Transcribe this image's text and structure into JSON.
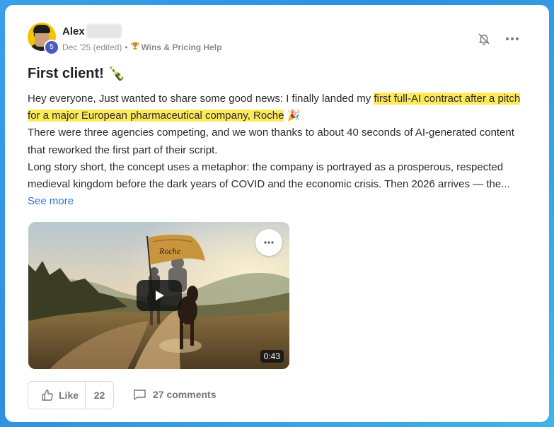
{
  "post": {
    "author": {
      "name": "Alex",
      "level": "5"
    },
    "meta": {
      "date": "Dec '25 (edited)",
      "separator": "•",
      "category": "Wins & Pricing Help"
    },
    "title": "First client! 🍾",
    "body": {
      "p1_start": "Hey everyone, Just wanted to share some good news: I finally landed my ",
      "p1_highlight": "first full-AI contract after a pitch for a major European pharmaceutical company, Roche",
      "p1_end": " 🎉",
      "p2": "There were three agencies competing, and we won thanks to about 40 seconds of AI-generated content that reworked the first part of their script.",
      "p3": "Long story short, the concept uses a metaphor: the company is portrayed as a prosperous, respected medieval kingdom before the dark years of COVID and the economic crisis. Then 2026 arrives — the... ",
      "see_more": "See more"
    },
    "video": {
      "duration": "0:43",
      "flag_text": "Roche"
    },
    "actions": {
      "like_label": "Like",
      "like_count": "22",
      "comments_label": "27 comments"
    }
  },
  "colors": {
    "highlight": "#fde95a",
    "link": "#2a74d4",
    "badge": "#4a5bc4",
    "frame": "#3aa0e8"
  },
  "icons": {
    "notification": "bell-off-icon",
    "menu": "more-horizontal-icon",
    "category": "trophy-icon",
    "like": "thumbs-up-icon",
    "comments": "comment-bubble-icon",
    "play": "play-icon"
  }
}
